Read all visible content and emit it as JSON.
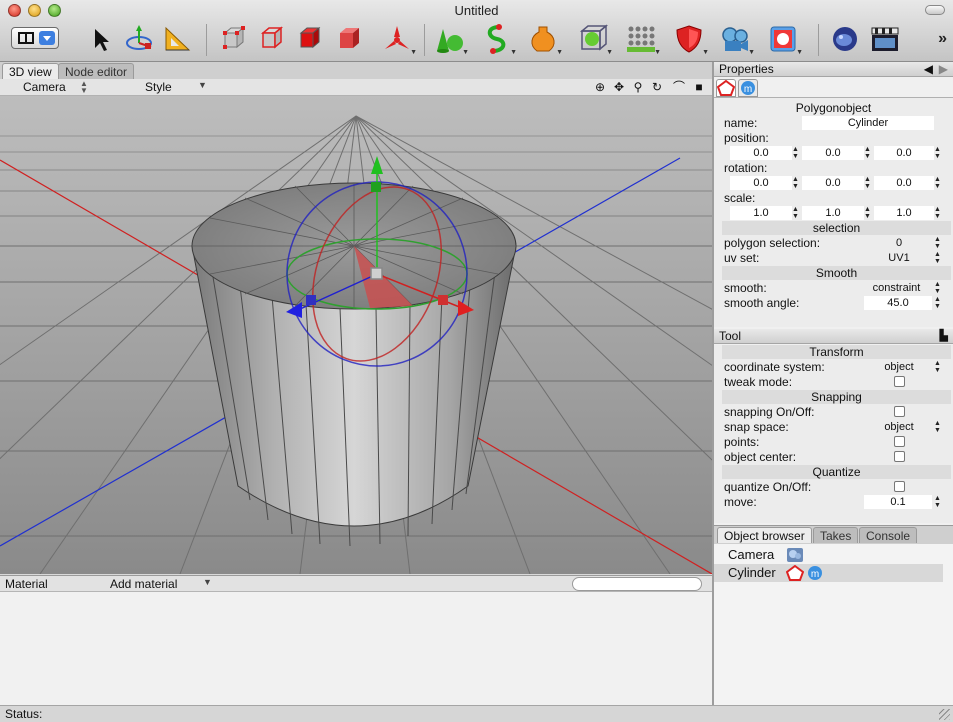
{
  "window": {
    "title": "Untitled"
  },
  "toolbar": {
    "tools": [
      "move-tool",
      "transform-tool",
      "measure-tool",
      "points-mode",
      "edges-mode",
      "polygons-mode",
      "object-mode",
      "modeling-axis",
      "primitives",
      "spline-tools",
      "deformers",
      "subdivision",
      "instances",
      "materials",
      "camera",
      "render-view",
      "render-settings",
      "render-movie"
    ],
    "overflow": "»"
  },
  "left_tabs": [
    "3D view",
    "Node editor"
  ],
  "view_header": {
    "camera": "Camera",
    "style": "Style"
  },
  "material_bar": {
    "label": "Material",
    "add": "Add material",
    "search_value": ""
  },
  "status": {
    "label": "Status:"
  },
  "properties": {
    "title": "Properties",
    "object_type": "Polygonobject",
    "name_label": "name:",
    "name_value": "Cylinder",
    "position_label": "position:",
    "position": [
      "0.0",
      "0.0",
      "0.0"
    ],
    "rotation_label": "rotation:",
    "rotation": [
      "0.0",
      "0.0",
      "0.0"
    ],
    "scale_label": "scale:",
    "scale": [
      "1.0",
      "1.0",
      "1.0"
    ],
    "selection_header": "selection",
    "polygon_selection_label": "polygon selection:",
    "polygon_selection_value": "0",
    "uv_set_label": "uv set:",
    "uv_set_value": "UV1",
    "smooth_header": "Smooth",
    "smooth_label": "smooth:",
    "smooth_value": "constraint",
    "smooth_angle_label": "smooth angle:",
    "smooth_angle_value": "45.0"
  },
  "tool": {
    "title": "Tool",
    "transform_header": "Transform",
    "coord_label": "coordinate system:",
    "coord_value": "object",
    "tweak_label": "tweak mode:",
    "snapping_header": "Snapping",
    "snapping_label": "snapping On/Off:",
    "snap_space_label": "snap space:",
    "snap_space_value": "object",
    "points_label": "points:",
    "object_center_label": "object center:",
    "quantize_header": "Quantize",
    "quantize_label": "quantize On/Off:",
    "move_label": "move:",
    "move_value": "0.1"
  },
  "object_browser": {
    "tabs": [
      "Object browser",
      "Takes",
      "Console"
    ],
    "items": [
      "Camera",
      "Cylinder"
    ]
  },
  "colors": {
    "accent": "#3d7fe0",
    "viewport_bg": "#8c8c8c",
    "axis_x": "#e02020",
    "axis_y": "#20b020",
    "axis_z": "#2030e0"
  }
}
